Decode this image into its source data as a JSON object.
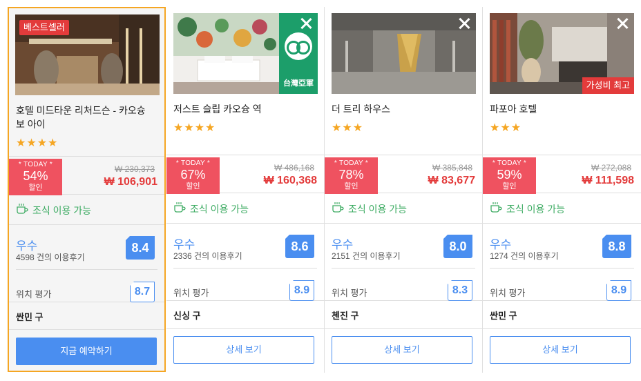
{
  "hotels": [
    {
      "name": "호텔 미드타운 리처드슨 - 카오슝 보 아이",
      "stars": "★★★★",
      "badge": "베스트셀러",
      "today_label": "* TODAY *",
      "discount": "54%",
      "discount_sub": "할인",
      "old_price": "₩ 230,373",
      "new_price": "₩ 106,901",
      "breakfast": "조식 이용 가능",
      "grade": "우수",
      "reviews": "4598 건의 이용후기",
      "score": "8.4",
      "location_label": "위치 평가",
      "location_score": "8.7",
      "district": "싼민 구",
      "button": "지금 예약하기"
    },
    {
      "name": "저스트 슬립 카오슝 역",
      "stars": "★★★★",
      "ta_text": "台灣亞軍",
      "today_label": "* TODAY *",
      "discount": "67%",
      "discount_sub": "할인",
      "old_price": "₩ 486,168",
      "new_price": "₩ 160,368",
      "breakfast": "조식 이용 가능",
      "grade": "우수",
      "reviews": "2336 건의 이용후기",
      "score": "8.6",
      "location_label": "위치 평가",
      "location_score": "8.9",
      "district": "신싱 구",
      "button": "상세 보기"
    },
    {
      "name": "더 트리 하우스",
      "stars": "★★★",
      "today_label": "* TODAY *",
      "discount": "78%",
      "discount_sub": "할인",
      "old_price": "₩ 385,848",
      "new_price": "₩ 83,677",
      "breakfast": "조식 이용 가능",
      "grade": "우수",
      "reviews": "2151 건의 이용후기",
      "score": "8.0",
      "location_label": "위치 평가",
      "location_score": "8.3",
      "district": "첸진 구",
      "button": "상세 보기"
    },
    {
      "name": "파포아 호텔",
      "stars": "★★★",
      "badge": "가성비 최고",
      "today_label": "* TODAY *",
      "discount": "59%",
      "discount_sub": "할인",
      "old_price": "₩ 272,088",
      "new_price": "₩ 111,598",
      "breakfast": "조식 이용 가능",
      "grade": "우수",
      "reviews": "1274 건의 이용후기",
      "score": "8.8",
      "location_label": "위치 평가",
      "location_score": "8.9",
      "district": "싼민 구",
      "button": "상세 보기"
    }
  ],
  "colors": {
    "accent": "#4a8ef0",
    "discount": "#ef5260",
    "price": "#e33b3b",
    "breakfast": "#3cab62",
    "highlight_border": "#f5a623"
  }
}
